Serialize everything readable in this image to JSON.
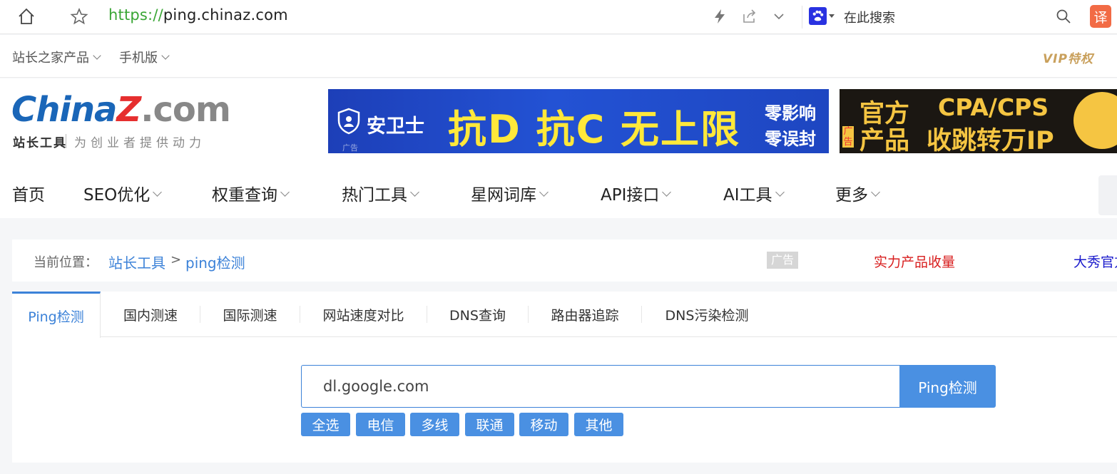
{
  "browser": {
    "url_protocol": "https://",
    "url_host": "ping.chinaz.com",
    "search_placeholder": "在此搜索",
    "translate_label": "译"
  },
  "topbar": {
    "products_label": "站长之家产品",
    "mobile_label": "手机版",
    "vip_label": "VIP特权"
  },
  "logo": {
    "brand_a": "China",
    "brand_z": "Z",
    "brand_com": ".com",
    "sub": "站长工具",
    "slogan": "为创业者提供动力"
  },
  "ads": {
    "banner1": {
      "brand": "安卫士",
      "headline": "抗D 抗C 无上限",
      "line1": "零影响",
      "line2": "零误封",
      "tag": "广告"
    },
    "banner2": {
      "line1a": "官方",
      "line2a": "产品",
      "line1b": "CPA/CPS",
      "line2b": "收跳转万IP",
      "tag": "广告"
    }
  },
  "nav": {
    "items": [
      {
        "label": "首页"
      },
      {
        "label": "SEO优化"
      },
      {
        "label": "权重查询"
      },
      {
        "label": "热门工具"
      },
      {
        "label": "星网词库"
      },
      {
        "label": "API接口"
      },
      {
        "label": "AI工具"
      },
      {
        "label": "更多"
      }
    ]
  },
  "breadcrumb": {
    "label": "当前位置：",
    "link1": "站长工具",
    "sep": ">",
    "link2": "ping检测",
    "ad_tag": "广告",
    "ad_text1": "实力产品收量",
    "ad_text2": "大秀官方"
  },
  "tabs": [
    {
      "label": "Ping检测"
    },
    {
      "label": "国内测速"
    },
    {
      "label": "国际测速"
    },
    {
      "label": "网站速度对比"
    },
    {
      "label": "DNS查询"
    },
    {
      "label": "路由器追踪"
    },
    {
      "label": "DNS污染检测"
    }
  ],
  "ping": {
    "input_value": "dl.google.com",
    "button_label": "Ping检测",
    "options": [
      {
        "label": "全选"
      },
      {
        "label": "电信"
      },
      {
        "label": "多线"
      },
      {
        "label": "联通"
      },
      {
        "label": "移动"
      },
      {
        "label": "其他"
      }
    ]
  },
  "colors": {
    "accent": "#4a90e2",
    "link": "#3c82d8",
    "ad_red": "#d81e1e",
    "ad_blue": "#1a1acc"
  }
}
